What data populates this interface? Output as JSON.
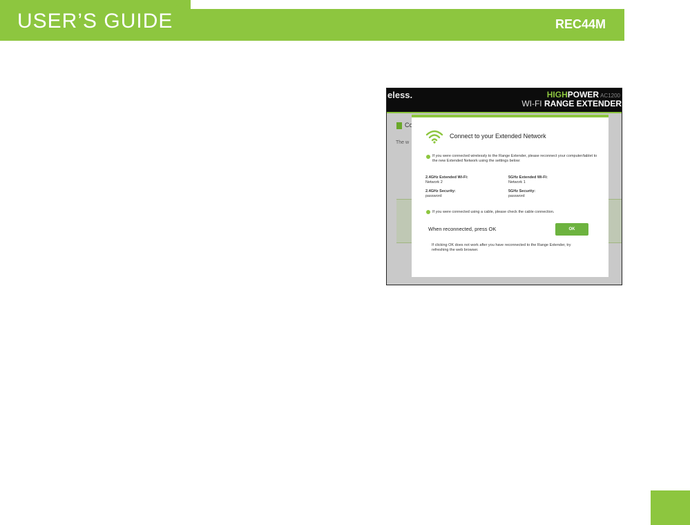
{
  "header": {
    "title": "USER’S GUIDE",
    "model": "REC44M"
  },
  "screenshot": {
    "brand_fragment": "eless.",
    "logo_high": "HIGH",
    "logo_power": "POWER",
    "logo_ac": "AC1200",
    "logo_wifi": "WI-FI",
    "logo_range_extender": "RANGE EXTENDER",
    "bg_heading_fragment": "Co",
    "bg_text_fragment": "The w",
    "modal": {
      "title": "Connect to your Extended Network",
      "wireless_note": "If you were connected wirelessly to the Range Extender, please reconnect your computer/tablet to the new Extended Network using the settings below:",
      "ext_24_label": "2.4GHz Extended Wi-Fi:",
      "ext_24_value": "Network 2",
      "ext_5_label": "5GHz Extended Wi-Fi:",
      "ext_5_value": "Network 1",
      "sec_24_label": "2.4GHz Security:",
      "sec_24_value": "password",
      "sec_5_label": "5GHz Security:",
      "sec_5_value": "password",
      "cable_note": "If you were connected using a cable, please check the cable connection.",
      "reconnected_text": "When reconnected, press OK",
      "ok_label": "OK",
      "footer_note": "If clicking OK does not work after you have reconnected to the Range Extender, try refreshing the web browser."
    }
  },
  "colors": {
    "brand_green": "#8dc63f",
    "button_green": "#6db33f"
  }
}
